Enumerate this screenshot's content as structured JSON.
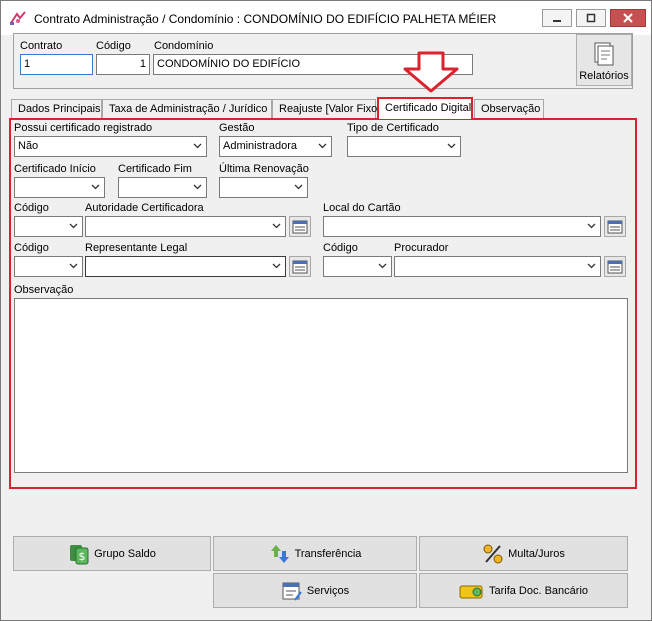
{
  "window": {
    "title": "Contrato Administração / Condomínio : CONDOMÍNIO DO EDIFÍCIO PALHETA MÉIER"
  },
  "header": {
    "contrato_label": "Contrato",
    "contrato_value": "1",
    "codigo_label": "Código",
    "codigo_value": "1",
    "condominio_label": "Condomínio",
    "condominio_value": "CONDOMÍNIO DO EDIFÍCIO",
    "relatorios_label": "Relatórios"
  },
  "tabs": [
    {
      "label": "Dados Principais"
    },
    {
      "label": "Taxa de Administração / Jurídico"
    },
    {
      "label": "Reajuste [Valor Fixo]"
    },
    {
      "label": "Certificado Digital"
    },
    {
      "label": "Observação"
    }
  ],
  "form": {
    "possui_label": "Possui certificado registrado",
    "possui_value": "Não",
    "gestao_label": "Gestão",
    "gestao_value": "Administradora",
    "tipo_label": "Tipo de Certificado",
    "tipo_value": "",
    "inicio_label": "Certificado Início",
    "fim_label": "Certificado Fim",
    "renovacao_label": "Última Renovação",
    "codigo1_label": "Código",
    "autoridade_label": "Autoridade Certificadora",
    "local_label": "Local do Cartão",
    "codigo2_label": "Código",
    "representante_label": "Representante Legal",
    "codigo3_label": "Código",
    "procurador_label": "Procurador",
    "observacao_label": "Observação"
  },
  "bottom_buttons": {
    "grupo_saldo": "Grupo Saldo",
    "transferencia": "Transferência",
    "multa_juros": "Multa/Juros",
    "servicos": "Serviços",
    "tarifa": "Tarifa Doc. Bancário"
  },
  "colors": {
    "highlight_red": "#d9232e",
    "accent_blue": "#3a78d6"
  }
}
